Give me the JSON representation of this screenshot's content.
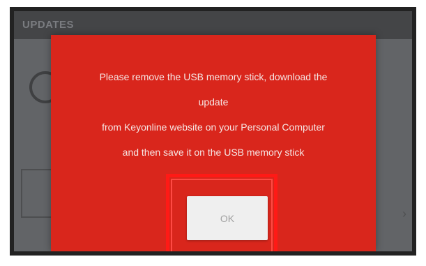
{
  "app": {
    "title": "UPDATES",
    "top_items": [
      "",
      "",
      ""
    ]
  },
  "dialog": {
    "lines": [
      "Please remove the USB memory stick, download the",
      "update",
      "from Keyonline website on your Personal Computer",
      "and then save it on the USB memory stick"
    ],
    "ok_label": "OK"
  },
  "colors": {
    "dialog_background": "#d9261c",
    "highlight": "#ff1a16",
    "button": "#efefef"
  }
}
